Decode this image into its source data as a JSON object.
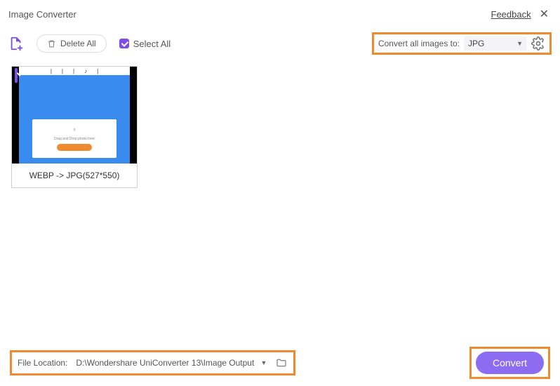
{
  "header": {
    "title": "Image Converter",
    "feedback": "Feedback"
  },
  "toolbar": {
    "delete_all": "Delete All",
    "select_all": "Select All",
    "convert_label": "Convert all images to:",
    "format": "JPG"
  },
  "thumb": {
    "drop_text": "Drag and Drop photo here",
    "caption": "WEBP -> JPG(527*550)"
  },
  "footer": {
    "loc_label": "File Location:",
    "loc_path": "D:\\Wondershare UniConverter 13\\Image Output",
    "convert": "Convert"
  }
}
